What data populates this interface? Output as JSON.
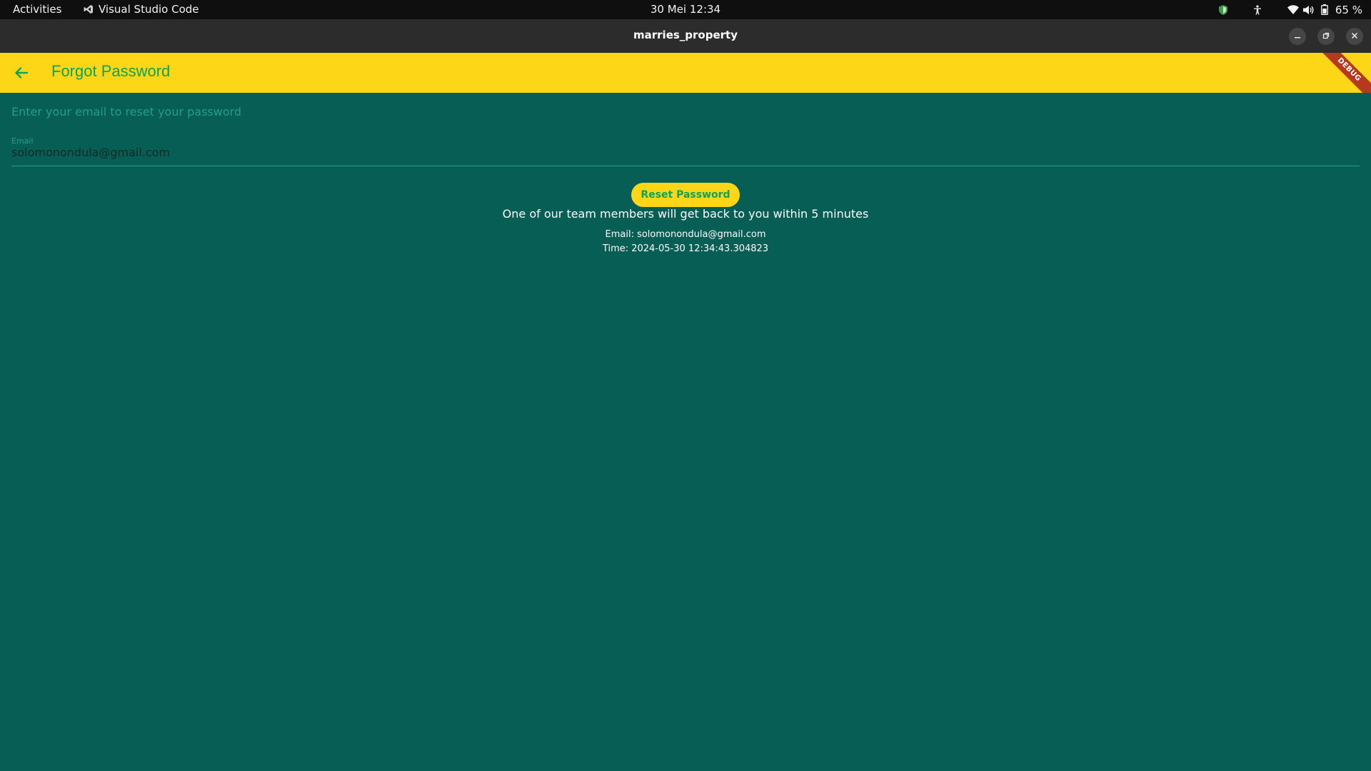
{
  "topbar": {
    "activities": "Activities",
    "app_name": "Visual Studio Code",
    "clock": "30 Mei  12:34",
    "battery": "65 %"
  },
  "window": {
    "title": "marries_property"
  },
  "appbar": {
    "title": "Forgot Password",
    "debug_banner": "DEBUG"
  },
  "form": {
    "instruction": "Enter your email to reset your password",
    "email_label": "Email",
    "email_value": "solomonondula@gmail.com",
    "button_label": "Reset Password"
  },
  "result": {
    "message": "One of our team members will get back to you within 5 minutes",
    "email_line": "Email: solomonondula@gmail.com",
    "time_line": "Time: 2024-05-30 12:34:43.304823"
  },
  "colors": {
    "accent": "#fdd617",
    "background": "#075e54",
    "title_green": "#0aa35a",
    "debug": "#b5391c"
  }
}
